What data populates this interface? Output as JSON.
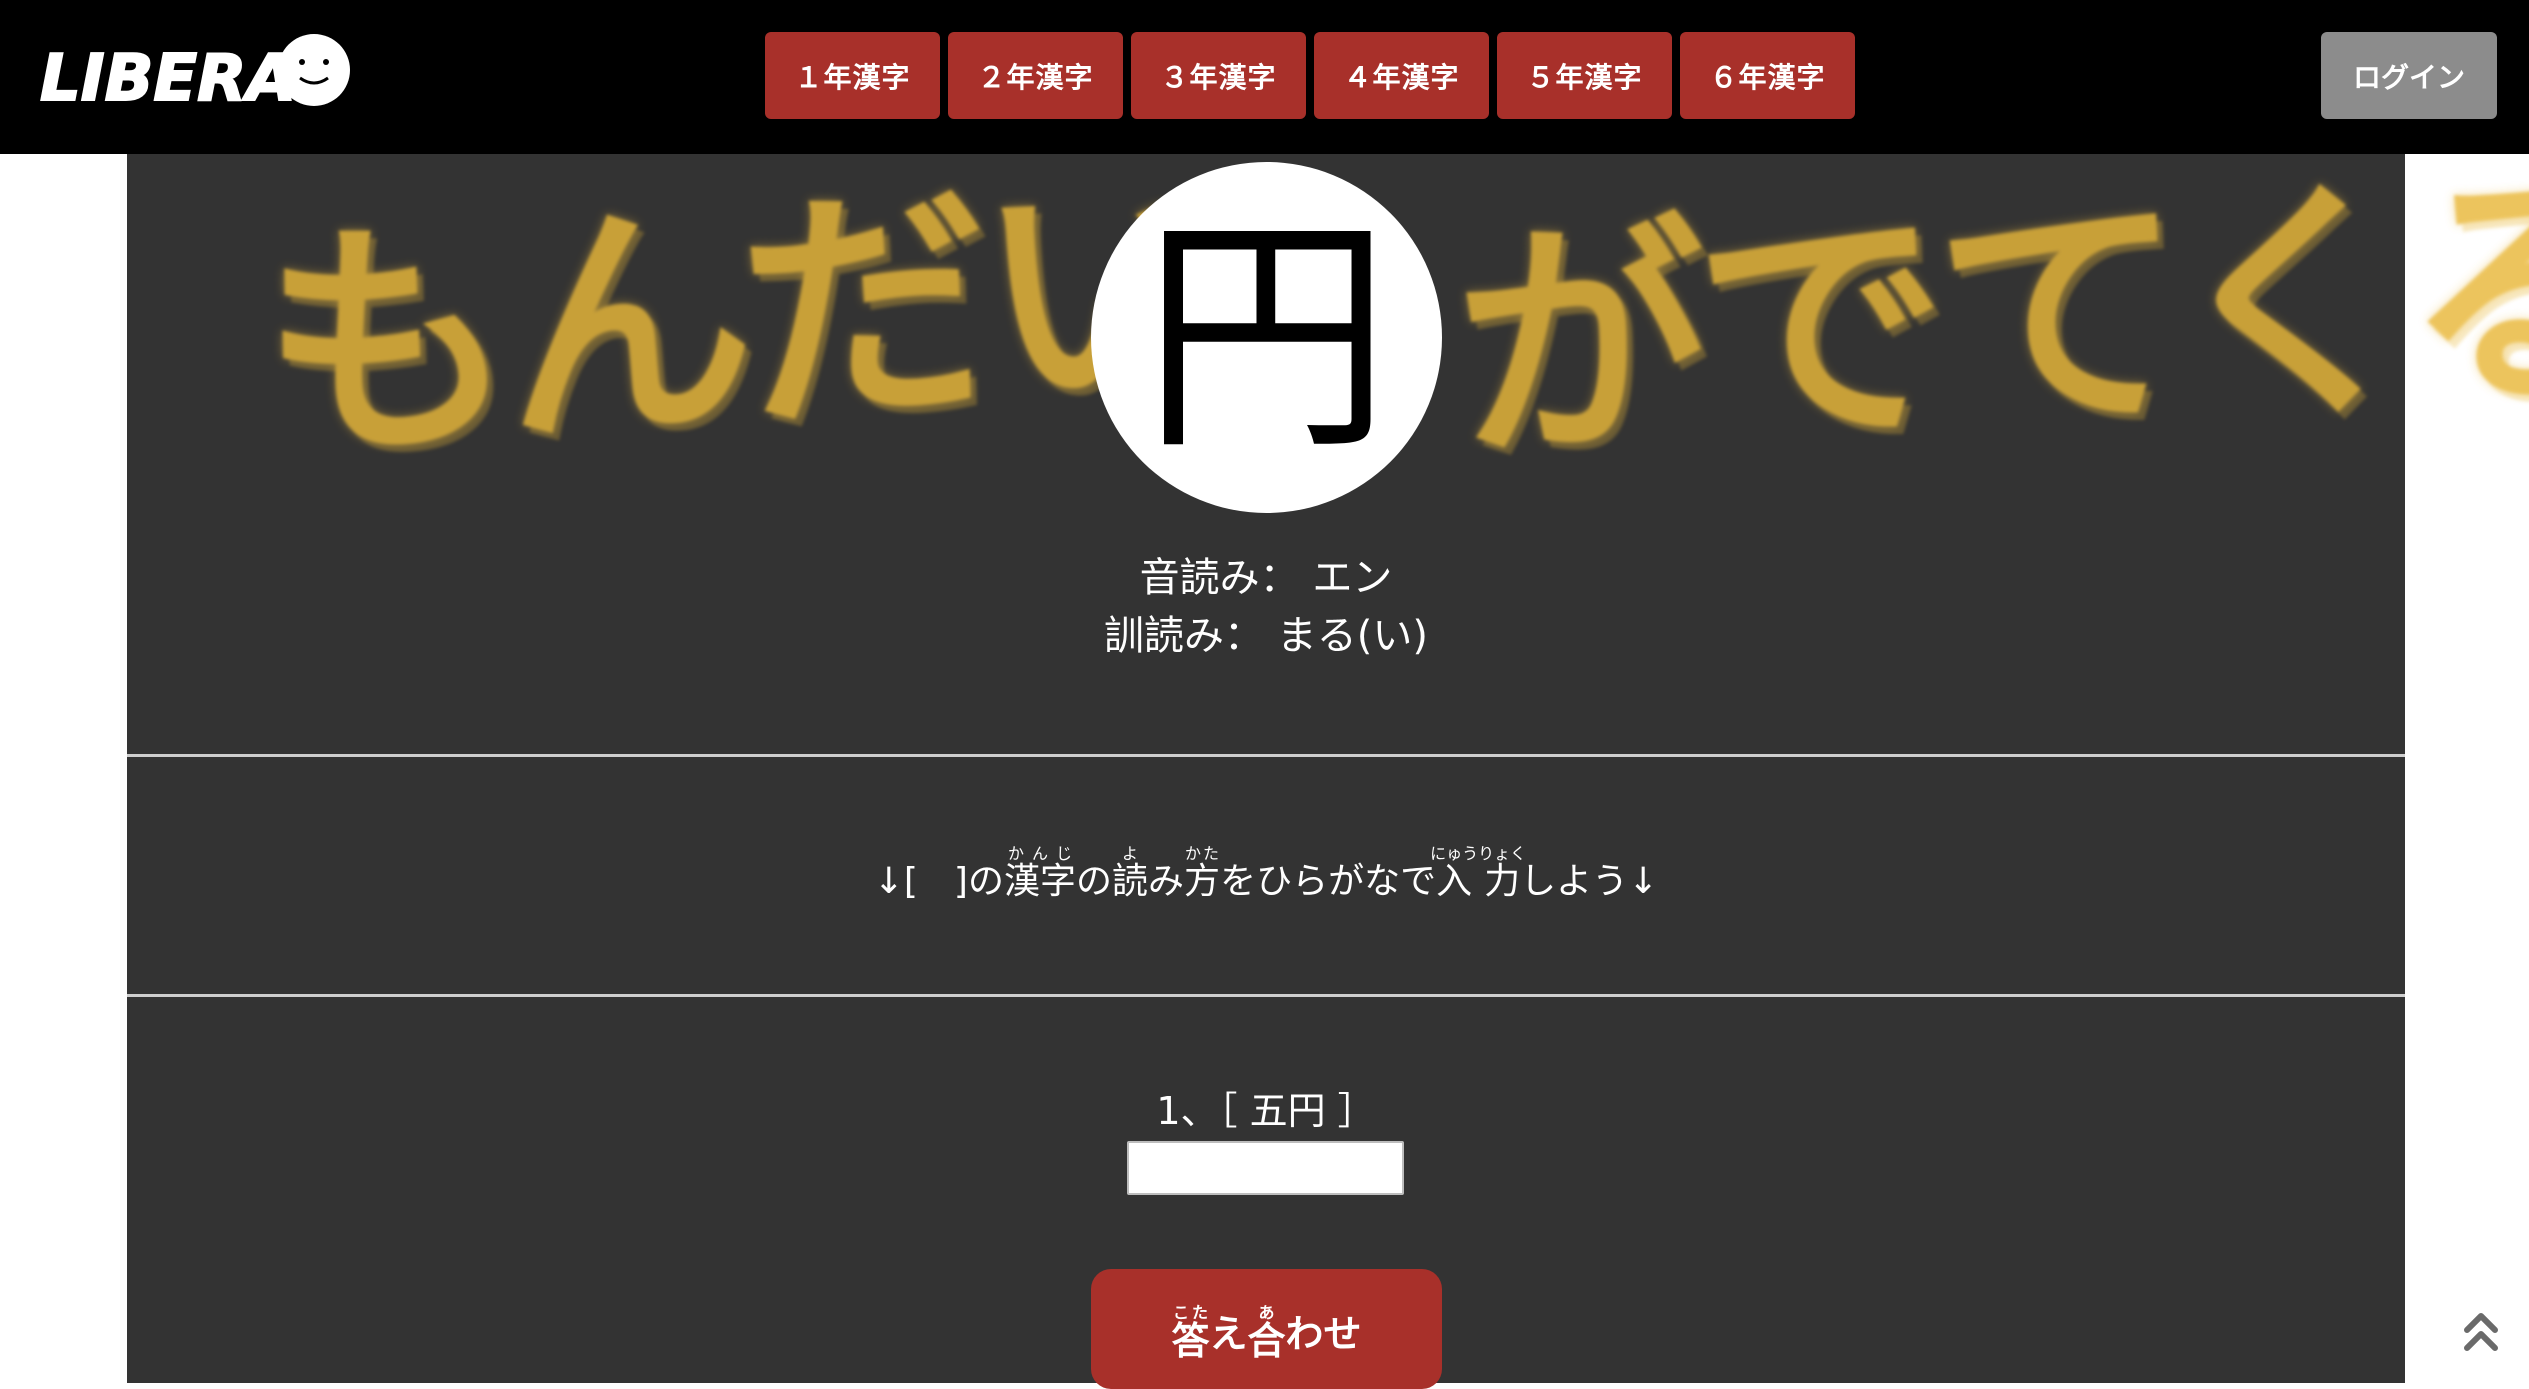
{
  "header": {
    "logo_text": "LIBERAL",
    "nav_items": [
      {
        "label": "１年漢字"
      },
      {
        "label": "２年漢字"
      },
      {
        "label": "３年漢字"
      },
      {
        "label": "４年漢字"
      },
      {
        "label": "５年漢字"
      },
      {
        "label": "６年漢字"
      }
    ],
    "login_label": "ログイン"
  },
  "hero": {
    "brush_left": "もんだい",
    "brush_right": "がでてくる",
    "kanji": "円",
    "on_reading": "音読み： エン",
    "kun_reading": "訓読み： まる(い)"
  },
  "instruction": {
    "arrow_left": "↓",
    "bracket": "[　]",
    "particle_no_1": "の",
    "kanji_word": "漢字",
    "kanji_word_ruby": "かんじ",
    "particle_no_2": "の",
    "yomi_kanji": "読",
    "yomi_ruby": "よ",
    "mi": "み",
    "kata_kanji": "方",
    "kata_ruby": "かた",
    "middle": "をひらがなで",
    "nyuuryoku_kanji": "入力",
    "nyuuryoku_ruby": "にゅうりょく",
    "ending": "しよう",
    "arrow_right": "↓"
  },
  "question": {
    "label": "1、［ 五円 ］",
    "input_value": "",
    "input_placeholder": ""
  },
  "check_button": {
    "kotae_kanji": "答",
    "kotae_ruby": "こた",
    "e": "え",
    "awase_kanji": "合",
    "awase_ruby": "あ",
    "wase": "わせ"
  },
  "colors": {
    "header_bg": "#000000",
    "panel_bg": "#333333",
    "accent_red": "#a8302a",
    "login_gray": "#8c8c8c",
    "brush_yellow": "#e9b83a"
  },
  "icons": {
    "scroll_top": "double-chevron-up-icon"
  }
}
